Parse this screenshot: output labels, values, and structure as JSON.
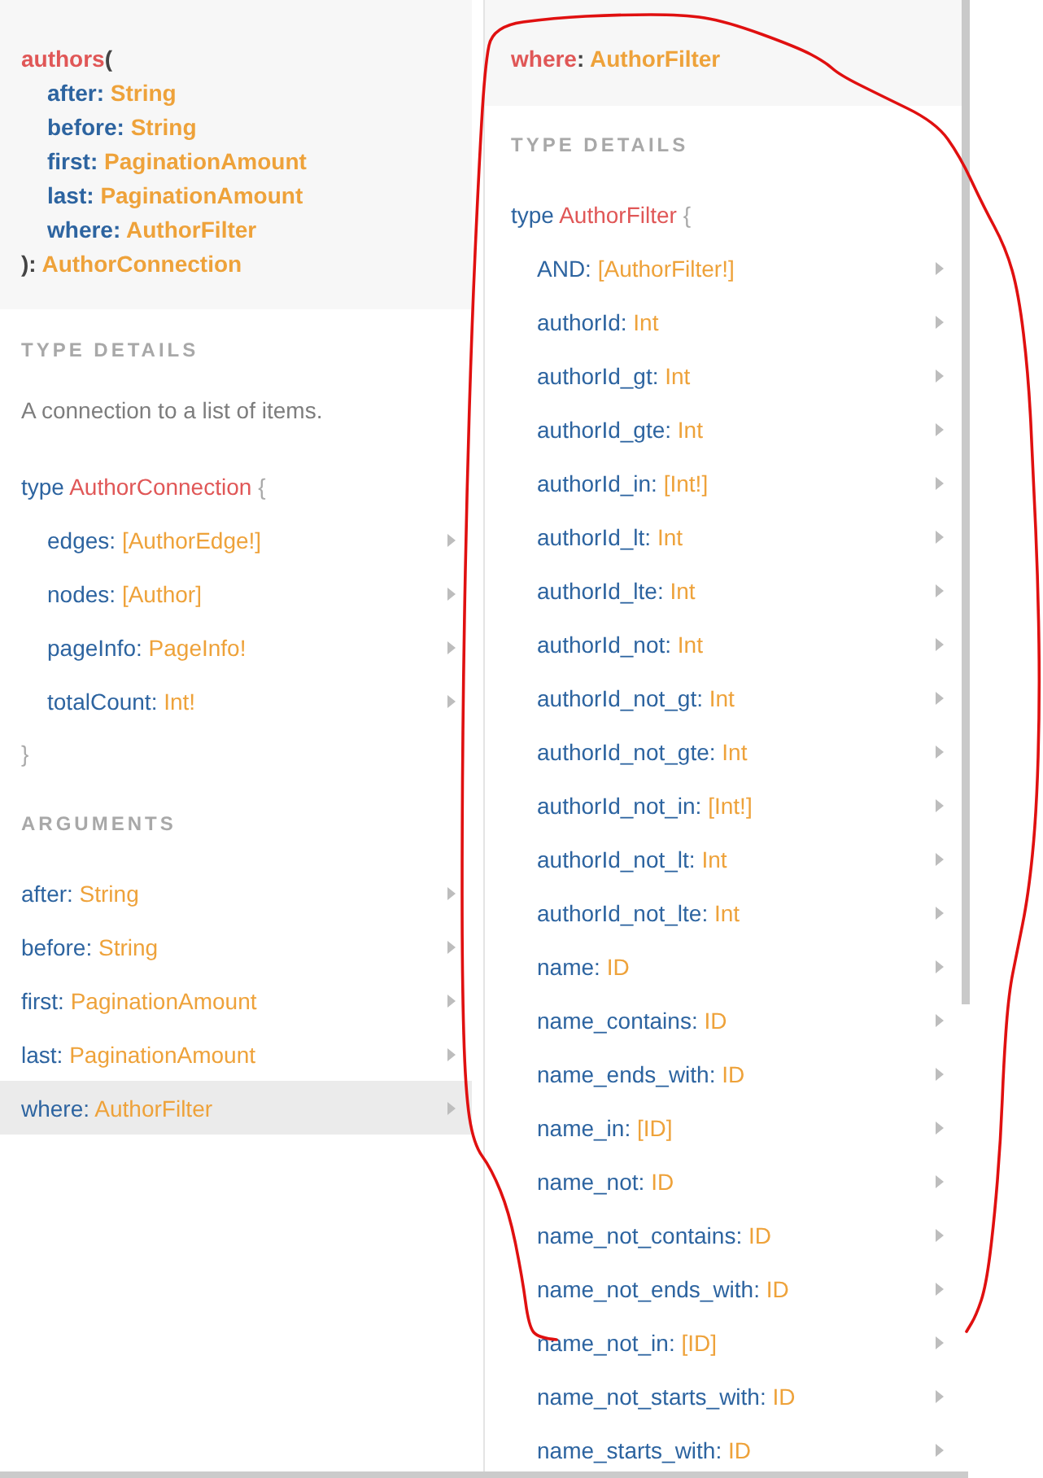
{
  "left_panel": {
    "signature": {
      "name": "authors",
      "open": "(",
      "args": [
        {
          "name": "after:",
          "type": "String"
        },
        {
          "name": "before:",
          "type": "String"
        },
        {
          "name": "first:",
          "type": "PaginationAmount"
        },
        {
          "name": "last:",
          "type": "PaginationAmount"
        },
        {
          "name": "where:",
          "type": "AuthorFilter"
        }
      ],
      "close": "):",
      "return_type": "AuthorConnection"
    },
    "type_details": {
      "heading": "TYPE DETAILS",
      "description": "A connection to a list of items.",
      "keyword": "type",
      "type_name": "AuthorConnection",
      "open": "{",
      "fields": [
        {
          "name": "edges:",
          "type": "[AuthorEdge!]"
        },
        {
          "name": "nodes:",
          "type": "[Author]"
        },
        {
          "name": "pageInfo:",
          "type": "PageInfo!"
        },
        {
          "name": "totalCount:",
          "type": "Int!"
        }
      ],
      "close": "}"
    },
    "arguments": {
      "heading": "ARGUMENTS",
      "items": [
        {
          "name": "after:",
          "type": "String",
          "selected": false
        },
        {
          "name": "before:",
          "type": "String",
          "selected": false
        },
        {
          "name": "first:",
          "type": "PaginationAmount",
          "selected": false
        },
        {
          "name": "last:",
          "type": "PaginationAmount",
          "selected": false
        },
        {
          "name": "where:",
          "type": "AuthorFilter",
          "selected": true
        }
      ]
    }
  },
  "right_panel": {
    "header": {
      "name": "where",
      "separator": ":",
      "type": "AuthorFilter"
    },
    "type_details": {
      "heading": "TYPE DETAILS",
      "keyword": "type",
      "type_name": "AuthorFilter",
      "open": "{",
      "fields": [
        {
          "name": "AND:",
          "type": "[AuthorFilter!]"
        },
        {
          "name": "authorId:",
          "type": "Int"
        },
        {
          "name": "authorId_gt:",
          "type": "Int"
        },
        {
          "name": "authorId_gte:",
          "type": "Int"
        },
        {
          "name": "authorId_in:",
          "type": "[Int!]"
        },
        {
          "name": "authorId_lt:",
          "type": "Int"
        },
        {
          "name": "authorId_lte:",
          "type": "Int"
        },
        {
          "name": "authorId_not:",
          "type": "Int"
        },
        {
          "name": "authorId_not_gt:",
          "type": "Int"
        },
        {
          "name": "authorId_not_gte:",
          "type": "Int"
        },
        {
          "name": "authorId_not_in:",
          "type": "[Int!]"
        },
        {
          "name": "authorId_not_lt:",
          "type": "Int"
        },
        {
          "name": "authorId_not_lte:",
          "type": "Int"
        },
        {
          "name": "name:",
          "type": "ID"
        },
        {
          "name": "name_contains:",
          "type": "ID"
        },
        {
          "name": "name_ends_with:",
          "type": "ID"
        },
        {
          "name": "name_in:",
          "type": "[ID]"
        },
        {
          "name": "name_not:",
          "type": "ID"
        },
        {
          "name": "name_not_contains:",
          "type": "ID"
        },
        {
          "name": "name_not_ends_with:",
          "type": "ID"
        },
        {
          "name": "name_not_in:",
          "type": "[ID]"
        },
        {
          "name": "name_not_starts_with:",
          "type": "ID"
        },
        {
          "name": "name_starts_with:",
          "type": "ID"
        }
      ]
    }
  },
  "annotation": {
    "kind": "freehand-loop"
  }
}
